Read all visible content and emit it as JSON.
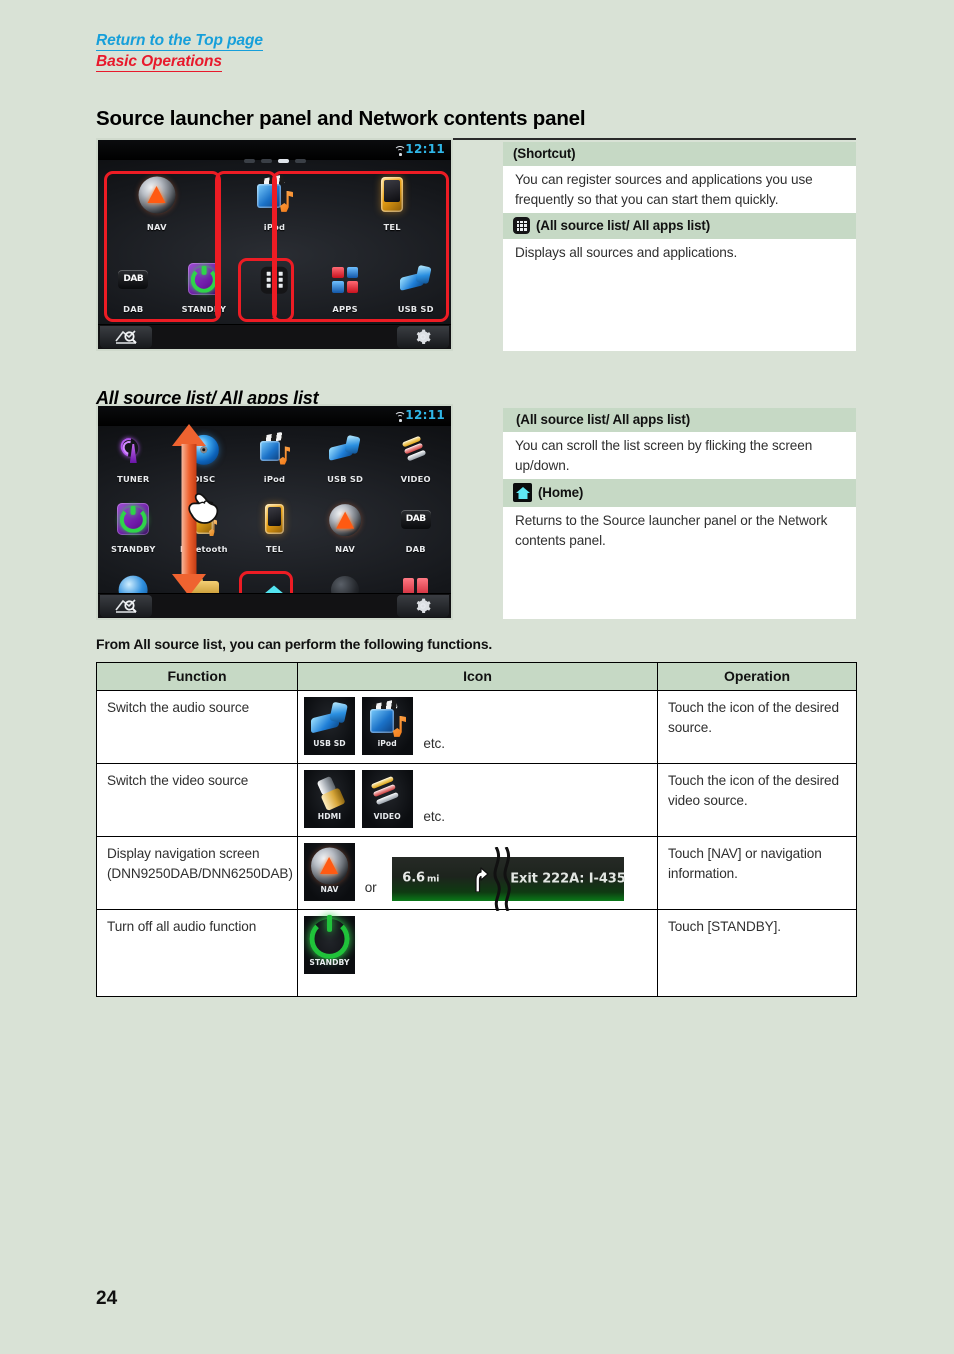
{
  "breadcrumbs": [
    {
      "label": "Return to the Top page",
      "color": "#169fda"
    },
    {
      "label": "Basic Operations",
      "color": "#e8192c"
    }
  ],
  "page_title": "Source launcher panel and Network contents panel",
  "section_title": "All source list/ All apps list",
  "page_number": "24",
  "device1": {
    "clock": "12:11",
    "apps_row1": [
      {
        "label": "NAV",
        "icon": "nav-icon"
      },
      {
        "label": "iPod",
        "icon": "ipod-icon"
      },
      {
        "label": "TEL",
        "icon": "tel-icon"
      }
    ],
    "apps_row2": [
      {
        "label": "DAB",
        "icon": "dab-icon"
      },
      {
        "label": "STANDBY",
        "icon": "standby-icon"
      },
      {
        "label": "",
        "icon": "all-source-list-icon"
      },
      {
        "label": "APPS",
        "icon": "apps-icon"
      },
      {
        "label": "USB SD",
        "icon": "usb-sd-icon"
      }
    ]
  },
  "device2": {
    "clock": "12:11",
    "apps_row1": [
      {
        "label": "TUNER",
        "icon": "tuner-icon"
      },
      {
        "label": "DISC",
        "icon": "disc-icon"
      },
      {
        "label": "iPod",
        "icon": "ipod-icon"
      },
      {
        "label": "USB SD",
        "icon": "usb-sd-icon"
      },
      {
        "label": "VIDEO",
        "icon": "video-icon"
      }
    ],
    "apps_row2": [
      {
        "label": "STANDBY",
        "icon": "standby-icon"
      },
      {
        "label": "Bluetooth",
        "icon": "bluetooth-icon"
      },
      {
        "label": "TEL",
        "icon": "tel-icon"
      },
      {
        "label": "NAV",
        "icon": "nav-icon"
      },
      {
        "label": "DAB",
        "icon": "dab-icon"
      }
    ],
    "apps_row3": [
      {
        "label": "",
        "icon": "disc-partial-icon"
      },
      {
        "label": "",
        "icon": "folder-partial-icon"
      },
      {
        "label": "",
        "icon": "home-icon"
      },
      {
        "label": "",
        "icon": "dim-partial-icon"
      },
      {
        "label": "",
        "icon": "apps-partial-icon"
      }
    ]
  },
  "panel1": {
    "header1": "(Shortcut)",
    "body1": "You can register sources and applications you use frequently so that you can start them quickly.",
    "header2": "(All source list/ All apps list)",
    "body2": "Displays all sources and applications."
  },
  "panel2": {
    "header1": " (All source list/ All apps list)",
    "body1": "You can scroll the list screen by flicking the screen up/down.",
    "header2": "(Home)",
    "body2": "Returns to the Source launcher panel or the Network contents panel."
  },
  "table_intro": "From All source list, you can perform the following functions.",
  "table": {
    "headers": [
      "Function",
      "Icon",
      "Operation"
    ],
    "rows": [
      {
        "function": "Switch the audio source",
        "icons": [
          {
            "label": "USB SD",
            "art": "usbsd"
          },
          {
            "label": "iPod",
            "art": "ipod"
          }
        ],
        "etc": "etc.",
        "operation": "Touch the icon of the desired source."
      },
      {
        "function": "Switch the video source",
        "icons": [
          {
            "label": "HDMI",
            "art": "hdmi"
          },
          {
            "label": "VIDEO",
            "art": "video"
          }
        ],
        "etc": "etc.",
        "operation": "Touch the icon of the desired video source."
      },
      {
        "function": "Display navigation screen (DNN9250DAB/DNN6250DAB)",
        "icons": [
          {
            "label": "NAV",
            "art": "nav"
          }
        ],
        "or": "or",
        "banner": {
          "distance": "6.6",
          "unit": "mi",
          "exit": "Exit 222A: I-435"
        },
        "operation": "Touch [NAV] or navigation information."
      },
      {
        "function": "Turn off all audio function",
        "icons": [
          {
            "label": "STANDBY",
            "art": "standby"
          }
        ],
        "operation": "Touch [STANDBY]."
      }
    ]
  },
  "colors": {
    "page_background": "#d9e2d6",
    "header_bar": "#c6d9c5",
    "link_blue": "#169fda",
    "link_red": "#e8192c",
    "highlight_red": "#ed1c24",
    "clock_blue": "#30b7e8"
  }
}
